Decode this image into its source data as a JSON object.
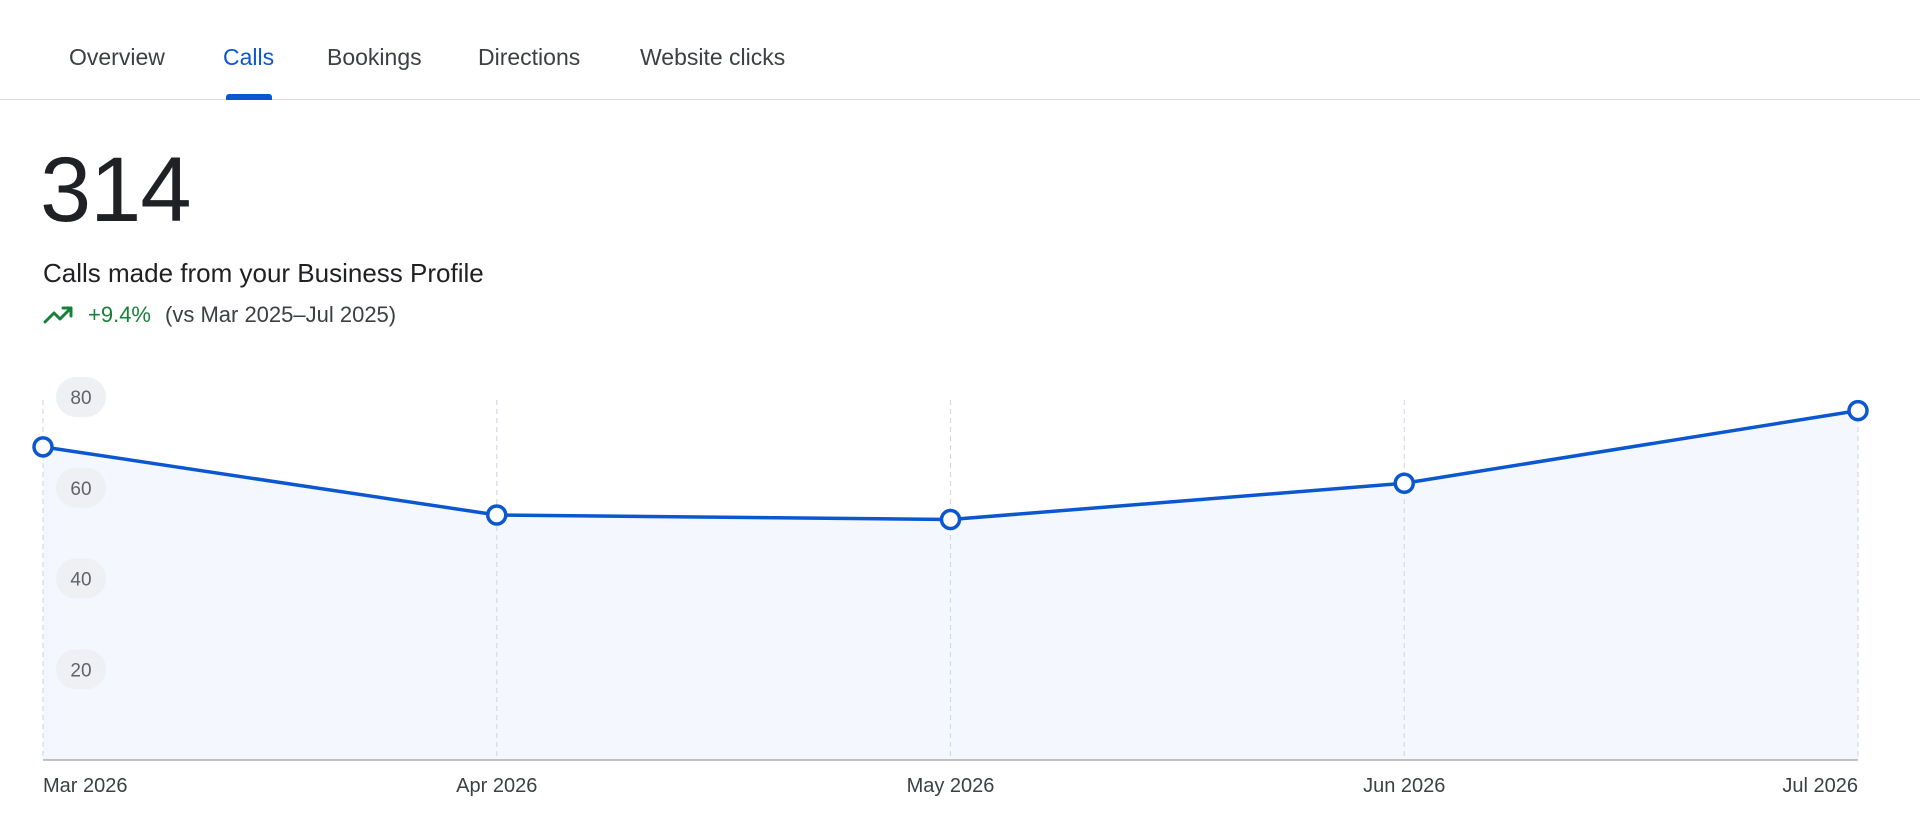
{
  "tabs": [
    {
      "label": "Overview",
      "active": false
    },
    {
      "label": "Calls",
      "active": true
    },
    {
      "label": "Bookings",
      "active": false
    },
    {
      "label": "Directions",
      "active": false
    },
    {
      "label": "Website clicks",
      "active": false
    }
  ],
  "metric": {
    "value": "314",
    "description": "Calls made from your Business Profile",
    "change": "+9.4%",
    "comparison": "(vs Mar 2025–Jul 2025)",
    "trend_icon": "trending-up-icon"
  },
  "colors": {
    "accent": "#0b57d0",
    "positive": "#188038",
    "area_fill": "#f4f7fd"
  },
  "chart_data": {
    "type": "area",
    "categories": [
      "Mar 2026",
      "Apr 2026",
      "May 2026",
      "Jun 2026",
      "Jul 2026"
    ],
    "values": [
      69,
      54,
      53,
      61,
      77
    ],
    "yticks": [
      "20",
      "40",
      "60",
      "80"
    ],
    "ytick_values": [
      20,
      40,
      60,
      80
    ],
    "ylim": [
      0,
      80
    ],
    "grid": "vertical-dashed"
  }
}
